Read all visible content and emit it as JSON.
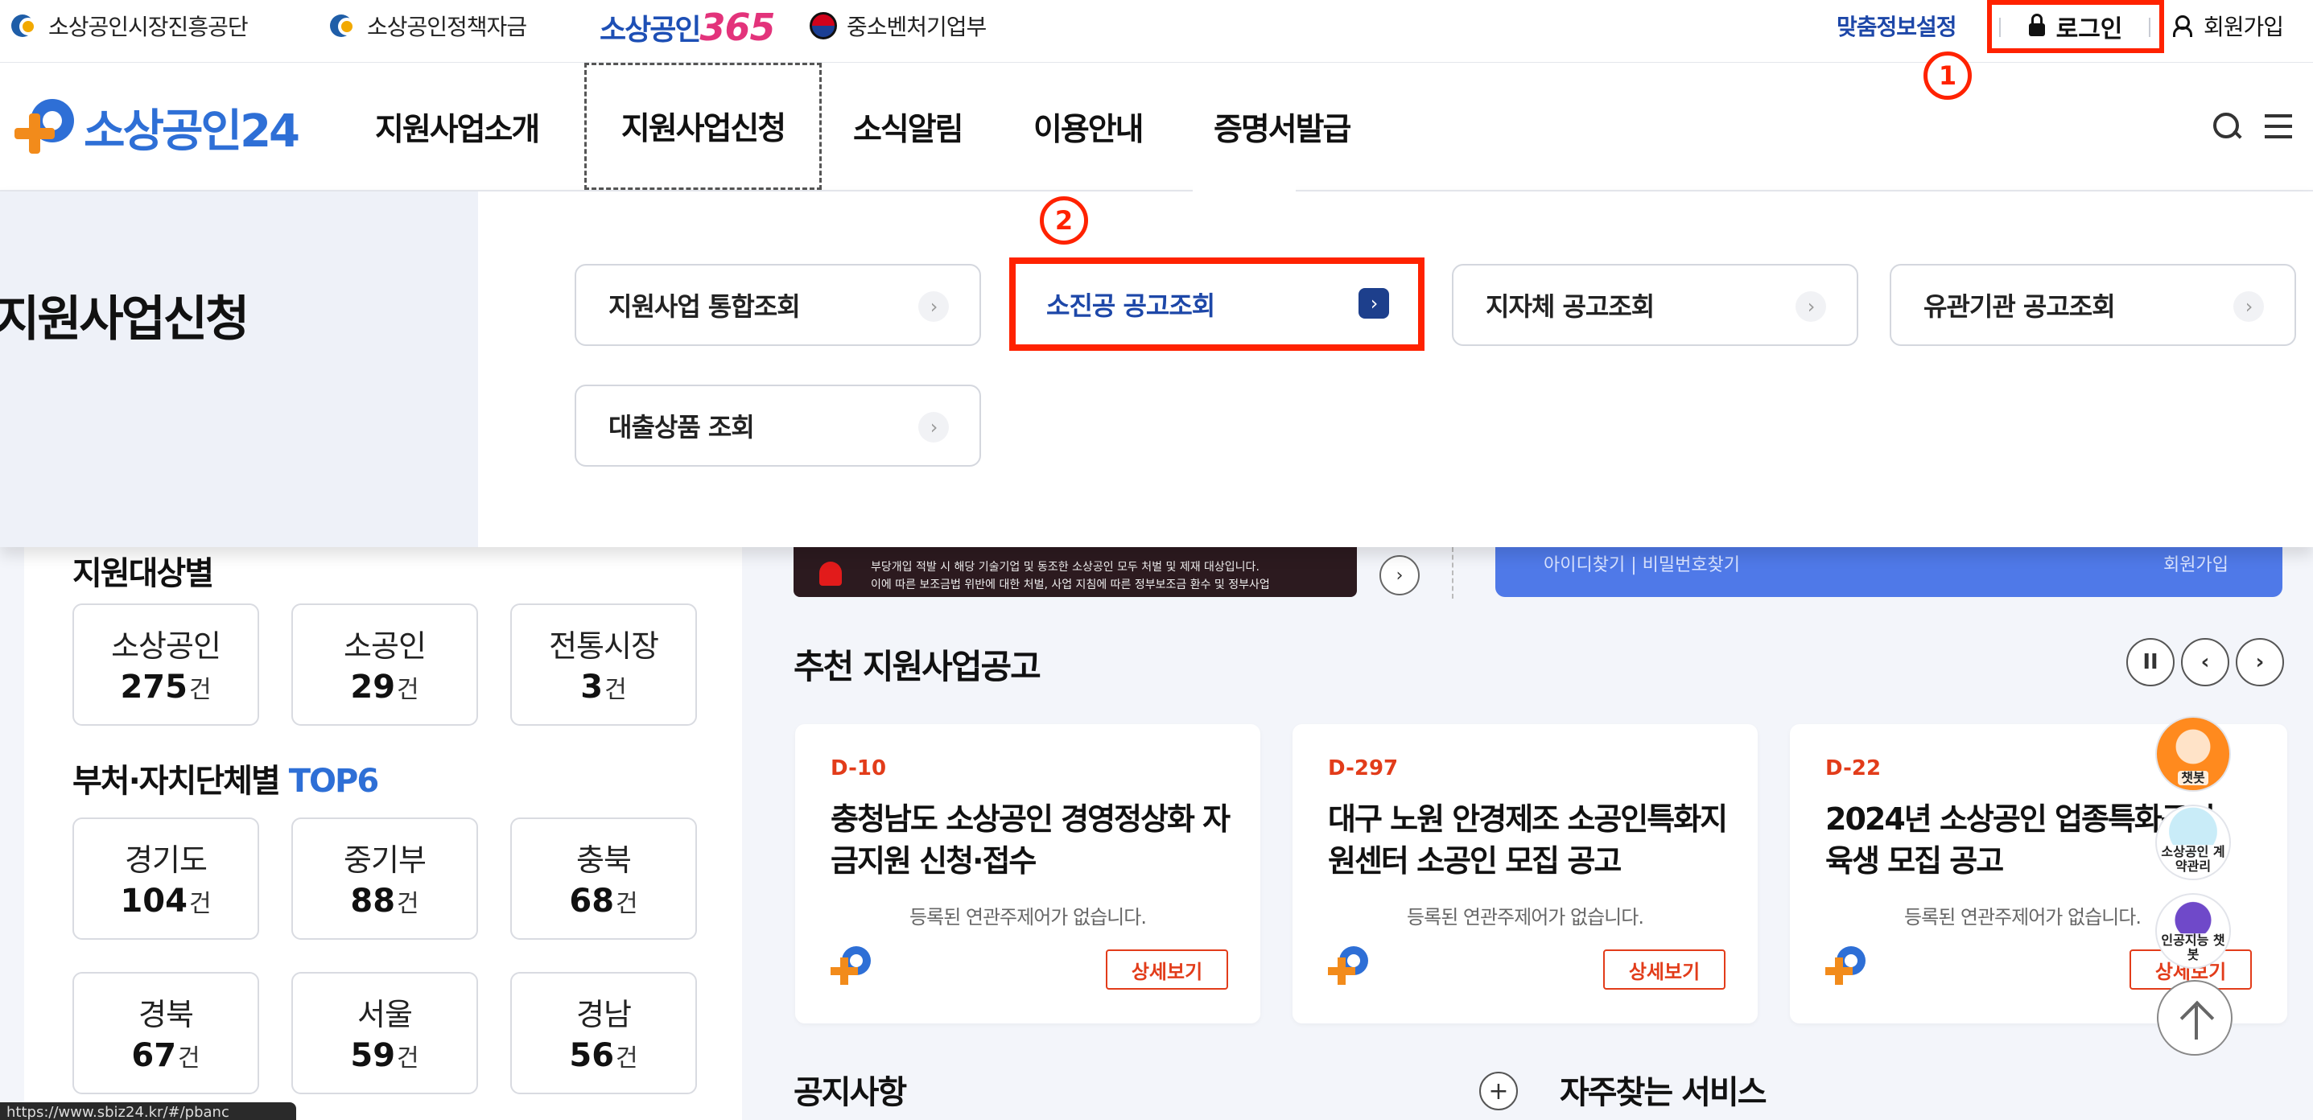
{
  "top_links": {
    "agency": "소상공인시장진흥공단",
    "policy_fund": "소상공인정책자금",
    "brand365_korean": "소상공인",
    "brand365_number": "365",
    "ministry": "중소벤처기업부"
  },
  "utility": {
    "custom_info": "맞춤정보설정",
    "login": "로그인",
    "signup": "회원가입"
  },
  "markers": {
    "one": "1",
    "two": "2"
  },
  "logo": {
    "text": "소상공인24"
  },
  "nav": {
    "items": [
      "지원사업소개",
      "지원사업신청",
      "소식알림",
      "이용안내",
      "증명서발급"
    ]
  },
  "dropdown": {
    "title": "지원사업신청",
    "buttons": [
      "지원사업 통합조회",
      "소진공 공고조회",
      "지자체 공고조회",
      "유관기관 공고조회",
      "대출상품 조회"
    ],
    "chevron": "›"
  },
  "sidebar": {
    "target_title": "지원대상별",
    "unit": "건",
    "targets": [
      {
        "label": "소상공인",
        "value": "275"
      },
      {
        "label": "소공인",
        "value": "29"
      },
      {
        "label": "전통시장",
        "value": "3"
      }
    ],
    "dept_title": "부처·자치단체별",
    "dept_title_accent": "TOP6",
    "depts": [
      {
        "label": "경기도",
        "value": "104"
      },
      {
        "label": "중기부",
        "value": "88"
      },
      {
        "label": "충북",
        "value": "68"
      },
      {
        "label": "경북",
        "value": "67"
      },
      {
        "label": "서울",
        "value": "59"
      },
      {
        "label": "경남",
        "value": "56"
      }
    ]
  },
  "banner": {
    "line1": "부당개입 적발 시 해당 기술기업 및 동조한 소상공인 모두 처벌 및 제재 대상입니다.",
    "line2": "이에 따른 보조금법 위반에 대한 처벌, 사업 지침에 따른 정부보조금 환수 및 정부사업",
    "blue_left": "아이디찾기  |  비밀번호찾기",
    "blue_right": "회원가입"
  },
  "recommend": {
    "title": "추천 지원사업공고",
    "pause": "II",
    "prev": "‹",
    "next": "›",
    "empty_text": "등록된 연관주제어가 없습니다.",
    "detail_label": "상세보기",
    "cards": [
      {
        "dday": "D-10",
        "title": "충청남도 소상공인 경영정상화 자금지원 신청·접수"
      },
      {
        "dday": "D-297",
        "title": "대구 노원 안경제조 소공인특화지원센터 소공인 모집 공고"
      },
      {
        "dday": "D-22",
        "title": "2024년 소상공인 업종특화구역 육생 모집 공고"
      }
    ]
  },
  "bottom": {
    "notice_title": "공지사항",
    "plus": "+",
    "faq_title": "자주찾는 서비스"
  },
  "fabs": {
    "chatbot": "챗봇",
    "contract": "소상공인 계약관리",
    "ai_chatbot": "인공지능 챗봇"
  },
  "status_url": "https://www.sbiz24.kr/#/pbanc"
}
